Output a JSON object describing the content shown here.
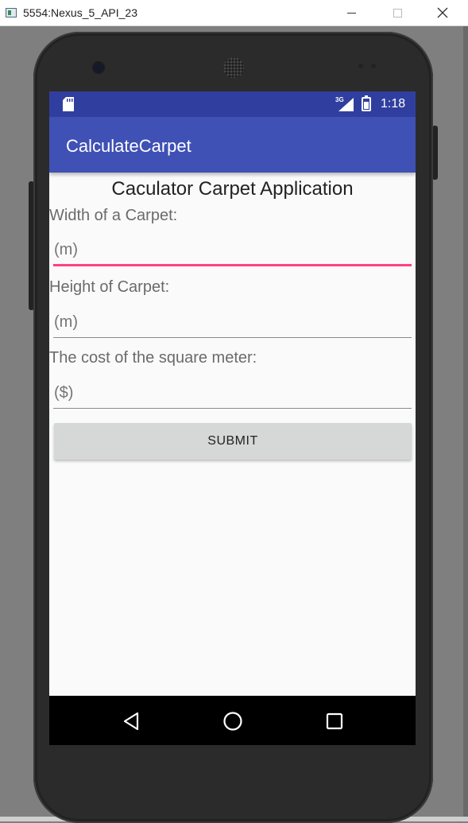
{
  "window": {
    "title": "5554:Nexus_5_API_23",
    "icon": "emulator-window-icon",
    "minimize_icon": "minimize-icon",
    "maximize_icon": "maximize-icon",
    "close_icon": "close-icon"
  },
  "status_bar": {
    "sd_icon": "sd-card-icon",
    "network_type": "3G",
    "signal_icon": "signal-icon",
    "battery_icon": "battery-charging-icon",
    "time": "1:18",
    "color": "#303f9f"
  },
  "app_bar": {
    "title": "CalculateCarpet",
    "color": "#3f51b5"
  },
  "content": {
    "title": "Caculator Carpet Application",
    "fields": [
      {
        "label": "Width of a Carpet:",
        "placeholder": "(m)",
        "value": ""
      },
      {
        "label": "Height of Carpet:",
        "placeholder": "(m)",
        "value": ""
      },
      {
        "label": "The cost of the square meter:",
        "placeholder": "($)",
        "value": ""
      }
    ],
    "submit_label": "SUBMIT",
    "accent_color": "#ff4081"
  },
  "nav_bar": {
    "back_icon": "back-triangle-icon",
    "home_icon": "home-circle-icon",
    "recent_icon": "recents-square-icon"
  }
}
